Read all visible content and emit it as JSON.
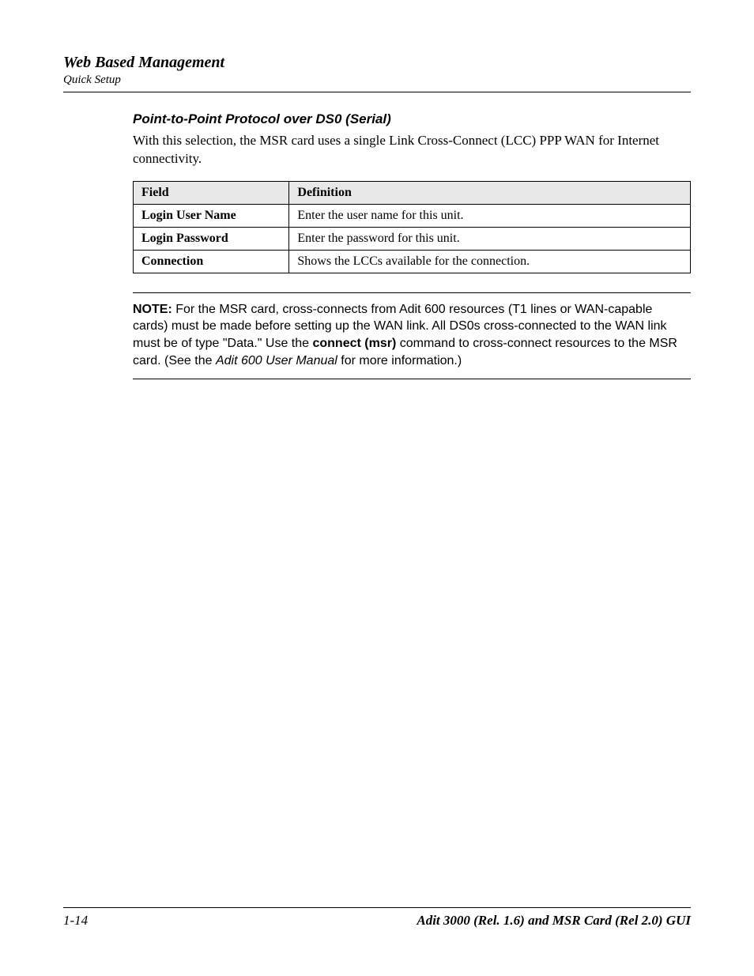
{
  "header": {
    "title": "Web Based Management",
    "subtitle": "Quick Setup"
  },
  "section": {
    "heading": "Point-to-Point Protocol over DS0 (Serial)",
    "intro": "With this selection, the MSR card uses a single Link Cross-Connect (LCC) PPP WAN for Internet connectivity."
  },
  "table": {
    "headers": {
      "col1": "Field",
      "col2": "Definition"
    },
    "rows": [
      {
        "field": "Login User Name",
        "definition": "Enter the user name for this unit."
      },
      {
        "field": "Login Password",
        "definition": "Enter the password for this unit."
      },
      {
        "field": "Connection",
        "definition": "Shows the LCCs available for the connection."
      }
    ]
  },
  "note": {
    "label": "NOTE:",
    "text_a": "  For the MSR card, cross-connects from Adit 600 resources (T1 lines or WAN-capable cards) must be made before setting up the WAN link.  All DS0s cross-connected to the WAN link must be of type \"Data.\"  Use the ",
    "cmd": "connect (msr)",
    "text_b": " command to cross-connect resources to the MSR card.  (See the ",
    "manual": "Adit 600 User Manual",
    "text_c": " for more information.)"
  },
  "footer": {
    "left": "1-14",
    "right": "Adit 3000 (Rel. 1.6) and MSR Card (Rel 2.0) GUI"
  }
}
